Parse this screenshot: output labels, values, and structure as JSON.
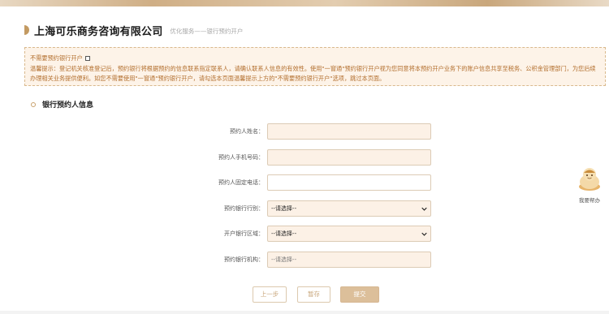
{
  "header": {
    "company_name": "上海可乐商务咨询有限公司",
    "breadcrumb": "优化服务——银行预约开户"
  },
  "notice": {
    "opt_out_label": "不需要预约银行开户",
    "opt_out_checked": false,
    "text": "温馨提示：登记机关核准登记后，预约银行将根据预约的信息联系指定联系人，请确认联系人信息的有效性。使用\"一窗通\"预约银行开户视为您同意将本预约开户业务下的账户信息共享至税务、公积金管理部门，为您后续办理相关业务提供便利。如您不需要使用\"一窗通\"预约银行开户，请勾选本页面温馨提示上方的\"不需要预约银行开户\"选项，跳过本页面。"
  },
  "section": {
    "title": "银行预约人信息"
  },
  "form": {
    "name_label": "预约人姓名：",
    "name_value": "",
    "mobile_label": "预约人手机号码：",
    "mobile_value": "",
    "phone_label": "预约人固定电话：",
    "phone_value": "",
    "bank_label": "预约银行行别：",
    "bank_value": "--请选择--",
    "region_label": "开户银行区域：",
    "region_value": "--请选择--",
    "branch_label": "预约银行机构：",
    "branch_value": "--请选择--"
  },
  "buttons": {
    "prev": "上一步",
    "save": "暂存",
    "submit": "提交"
  },
  "helper": {
    "label": "我要帮办"
  },
  "colors": {
    "accent": "#c39a62",
    "notice_text": "#b36f2e",
    "notice_bg": "#fdf3e8",
    "input_bg": "#fcf1e6",
    "submit_bg": "#dcbf9a"
  }
}
